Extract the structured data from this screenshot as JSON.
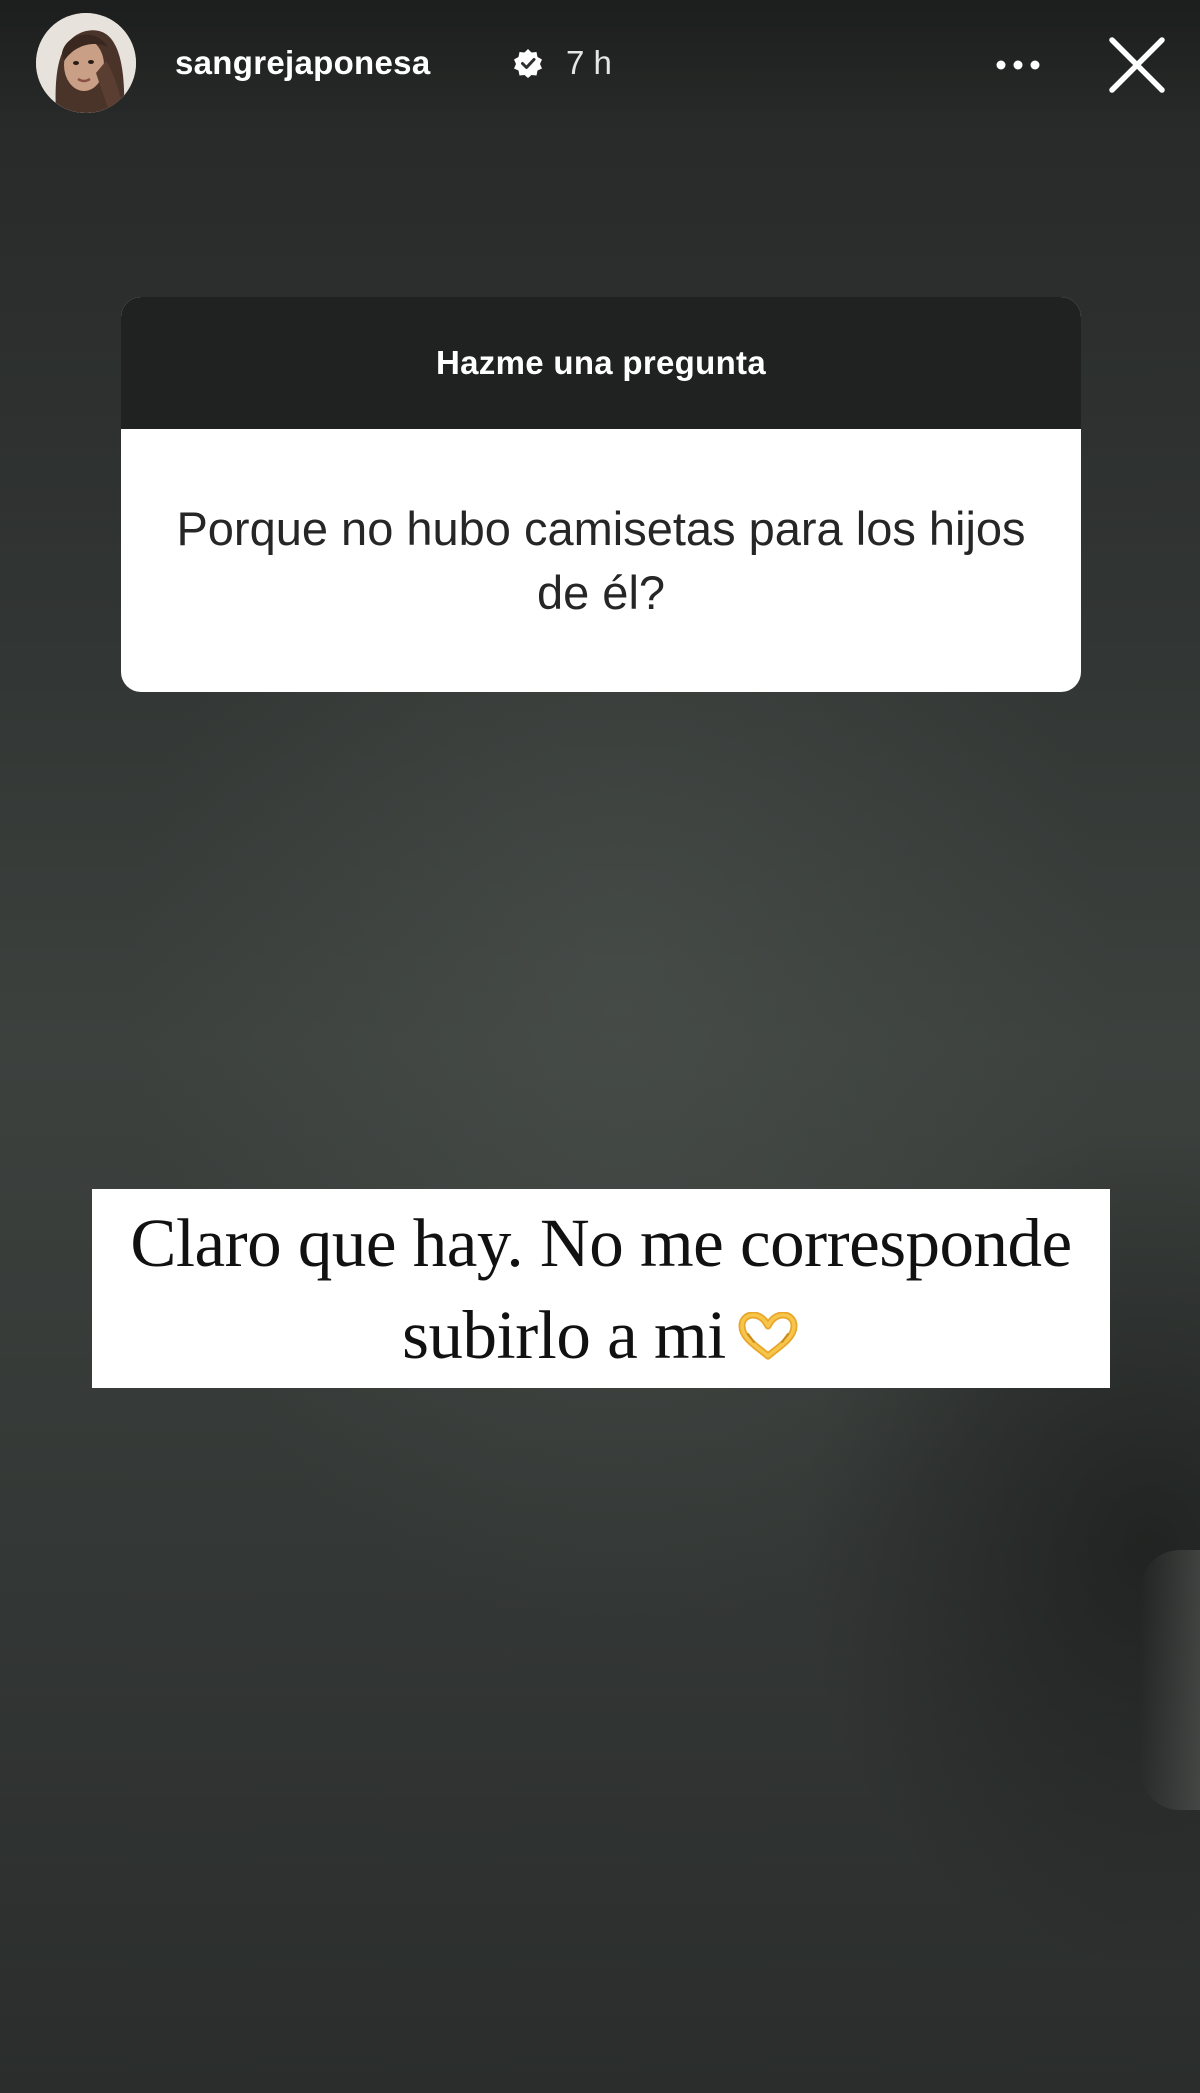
{
  "story": {
    "header": {
      "username": "sangrejaponesa",
      "verified_icon": "verified-badge-icon",
      "time": "7 h",
      "more_icon": "more-options-icon",
      "close_icon": "close-icon"
    },
    "question_sticker": {
      "title": "Hazme una pregunta",
      "question": "Porque no hubo camisetas para los hijos de él?"
    },
    "answer": {
      "text": "Claro que hay. No me corresponde subirlo a mi",
      "emoji_icon": "heart-hands-icon"
    },
    "colors": {
      "background": "#313533",
      "sticker_header": "#202121",
      "sticker_body": "#ffffff",
      "answer_box": "#ffffff",
      "emoji": "#f2b233"
    }
  }
}
